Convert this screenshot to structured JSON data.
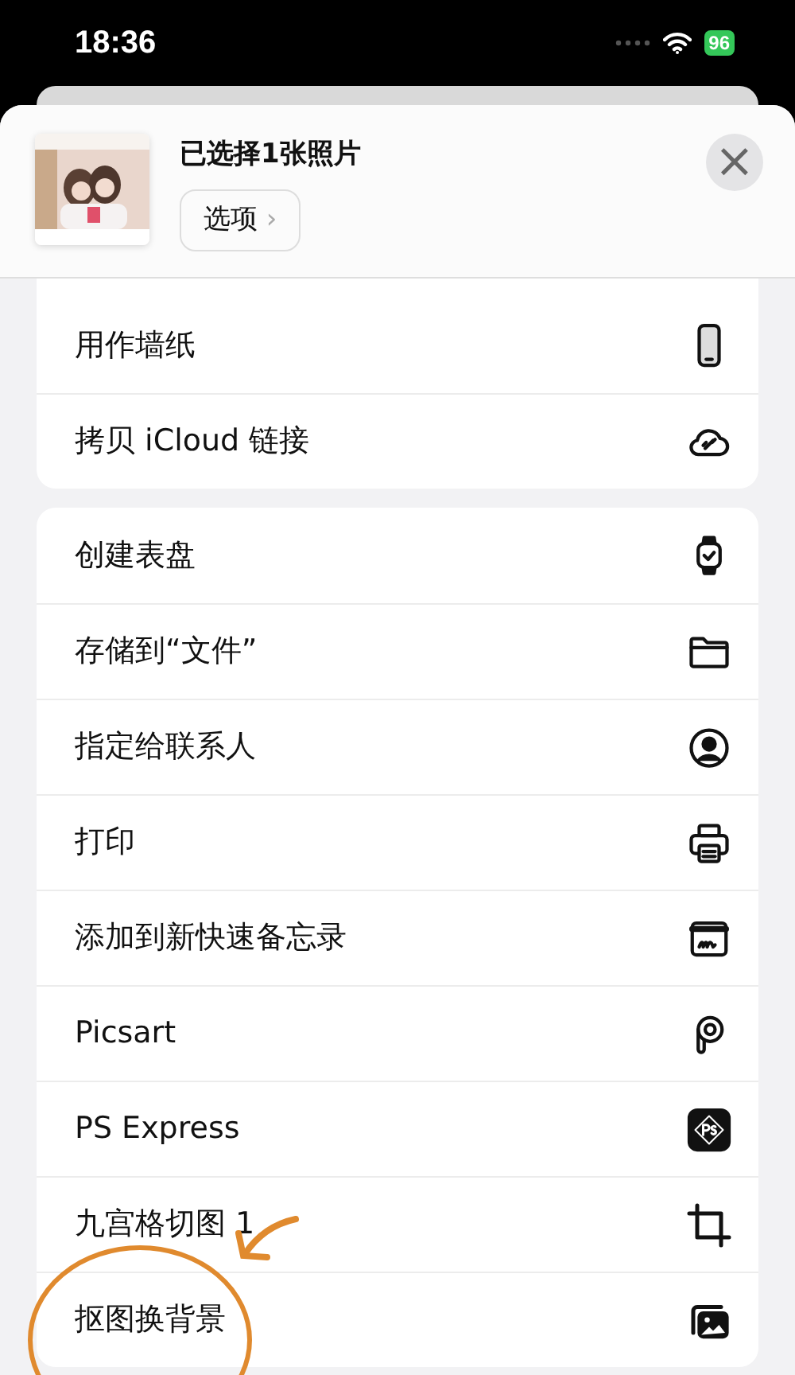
{
  "status_bar": {
    "time": "18:36",
    "battery": "96"
  },
  "share_header": {
    "title": "已选择1张照片",
    "options_button": "选项",
    "chevron": "›",
    "close": "×"
  },
  "groups": [
    {
      "items": [
        {
          "label": "用作墙纸"
        },
        {
          "label": "拷贝 iCloud 链接"
        }
      ]
    },
    {
      "items": [
        {
          "label": "创建表盘"
        },
        {
          "label": "存储到“文件”"
        },
        {
          "label": "指定给联系人"
        },
        {
          "label": "打印"
        },
        {
          "label": "添加到新快速备忘录"
        },
        {
          "label": "Picsart"
        },
        {
          "label": "PS Express"
        },
        {
          "label": "九宫格切图 1"
        },
        {
          "label": "抠图换背景"
        }
      ]
    }
  ]
}
